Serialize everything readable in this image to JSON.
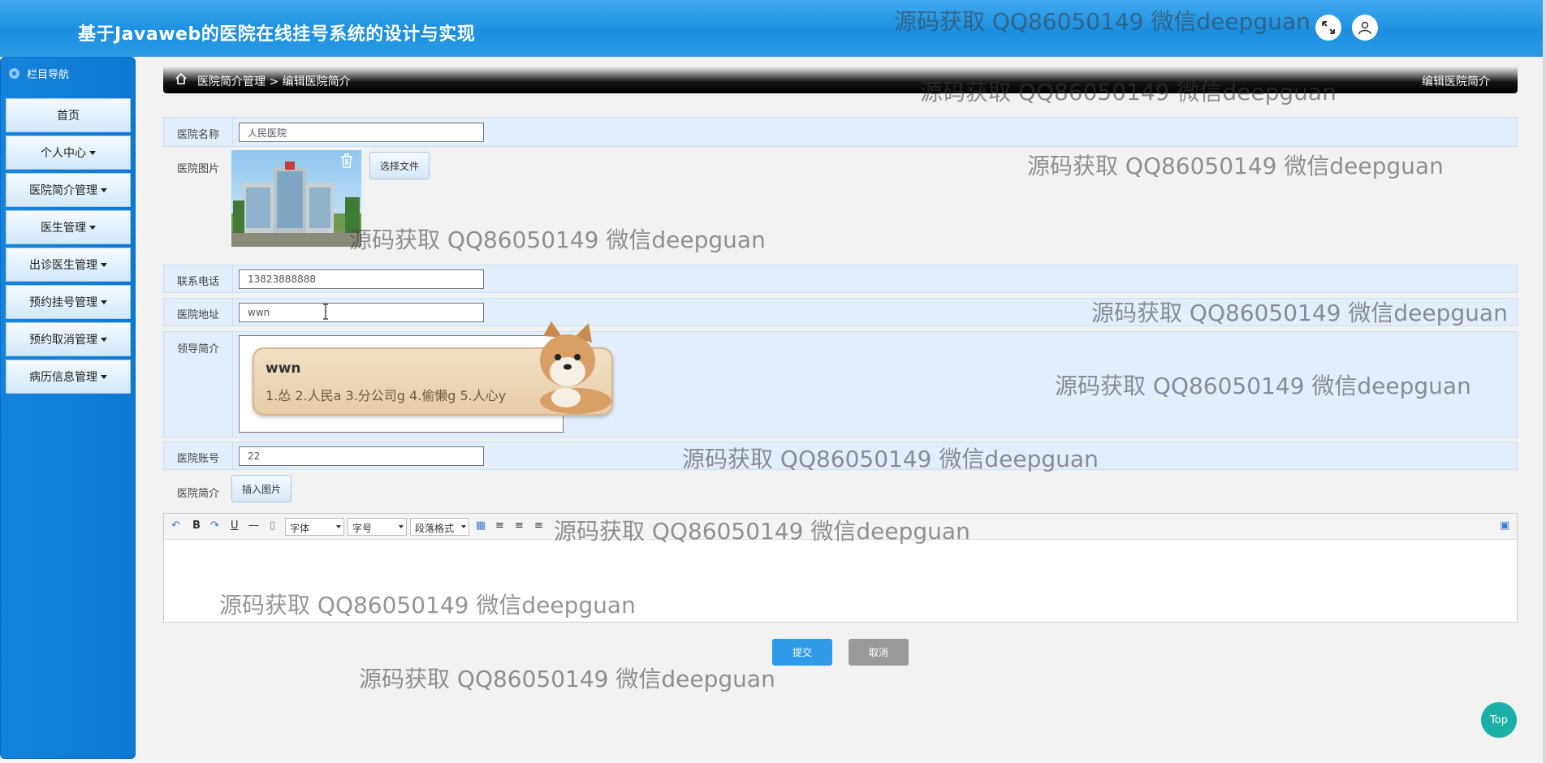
{
  "app": {
    "title": "基于Javaweb的医院在线挂号系统的设计与实现"
  },
  "header": {
    "fullscreen_icon": "fullscreen-icon",
    "user_icon": "user-icon"
  },
  "sidebar": {
    "title": "栏目导航",
    "items": [
      {
        "label": "首页",
        "has_caret": false
      },
      {
        "label": "个人中心",
        "has_caret": true
      },
      {
        "label": "医院简介管理",
        "has_caret": true
      },
      {
        "label": "医生管理",
        "has_caret": true
      },
      {
        "label": "出诊医生管理",
        "has_caret": true
      },
      {
        "label": "预约挂号管理",
        "has_caret": true
      },
      {
        "label": "预约取消管理",
        "has_caret": true
      },
      {
        "label": "病历信息管理",
        "has_caret": true
      }
    ]
  },
  "breadcrumb": {
    "path": "医院简介管理 > 编辑医院简介",
    "page_title": "编辑医院简介"
  },
  "form": {
    "name": {
      "label": "医院名称",
      "value": "人民医院"
    },
    "image": {
      "label": "医院图片",
      "choose_file": "选择文件"
    },
    "phone": {
      "label": "联系电话",
      "value": "13823888888"
    },
    "address": {
      "label": "医院地址",
      "value": "wwn"
    },
    "leader": {
      "label": "领导简介"
    },
    "account": {
      "label": "医院账号",
      "value": "22"
    },
    "intro": {
      "label": "医院简介",
      "insert_image": "插入图片"
    }
  },
  "ime": {
    "input": "wwn",
    "candidates": "1.怂  2.人民a  3.分公司g  4.偷懒g  5.人心y"
  },
  "editor": {
    "font": "字体",
    "size": "字号",
    "paragraph": "段落格式"
  },
  "actions": {
    "submit": "提交",
    "cancel": "取消",
    "top": "Top"
  },
  "watermark": "源码获取 QQ86050149 微信deepguan",
  "colors": {
    "header": "#1b8fe0",
    "sidebar": "#1583db",
    "row_bg": "#e2eefb",
    "submit": "#2f9be8",
    "top_button": "#1ab0a8"
  }
}
